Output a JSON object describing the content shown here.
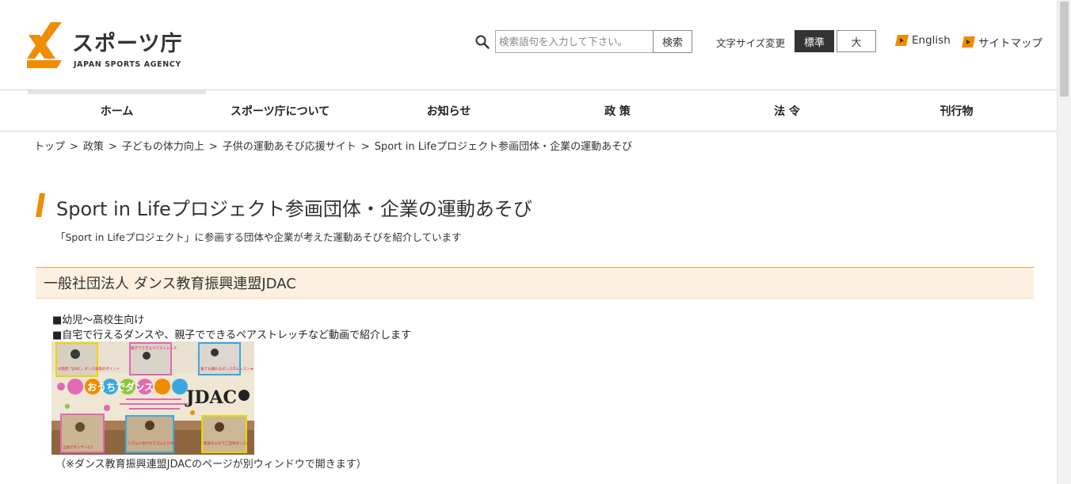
{
  "header": {
    "logo_jp": "スポーツ庁",
    "logo_en": "JAPAN SPORTS AGENCY",
    "search": {
      "placeholder": "検索語句を入力して下さい。",
      "button": "検索"
    },
    "font_size": {
      "label": "文字サイズ変更",
      "standard": "標準",
      "large": "大"
    },
    "links": {
      "english": "English",
      "sitemap": "サイトマップ"
    }
  },
  "nav": {
    "items": [
      "ホーム",
      "スポーツ庁について",
      "お知らせ",
      "政 策",
      "法 令",
      "刊行物"
    ]
  },
  "breadcrumb": [
    "トップ",
    "政策",
    "子どもの体力向上",
    "子供の運動あそび応援サイト",
    "Sport in Lifeプロジェクト参画団体・企業の運動あそび"
  ],
  "breadcrumb_separator": ">",
  "page": {
    "title": "Sport in Lifeプロジェクト参画団体・企業の運動あそび",
    "description": "「Sport in Lifeプロジェクト」に参画する団体や企業が考えた運動あそびを紹介しています"
  },
  "section": {
    "heading": "一般社団法人 ダンス教育振興連盟JDAC",
    "bullets": [
      "■幼児～高校生向け",
      "■自宅で行えるダンスや、親子でできるペアストレッチなど動画で紹介します"
    ],
    "banner": {
      "title": "おうちでダンス",
      "logo": "JDAC",
      "captions": [
        "大阪府「JDAC」ダンス体操のポイント",
        "親子でできるペアストレッチ",
        "誰でも踊れるダンスのレッスン★",
        "全員がダンサーに？",
        "リズムに合わせてゴムとびダンス",
        "家族みんなでご当地ダンス★"
      ]
    },
    "note": "（※ダンス教育振興連盟JDACのページが別ウィンドウで開きます）"
  },
  "colors": {
    "accent": "#f08c00",
    "section_bg": "#fdf0e0",
    "active_button": "#333333"
  }
}
